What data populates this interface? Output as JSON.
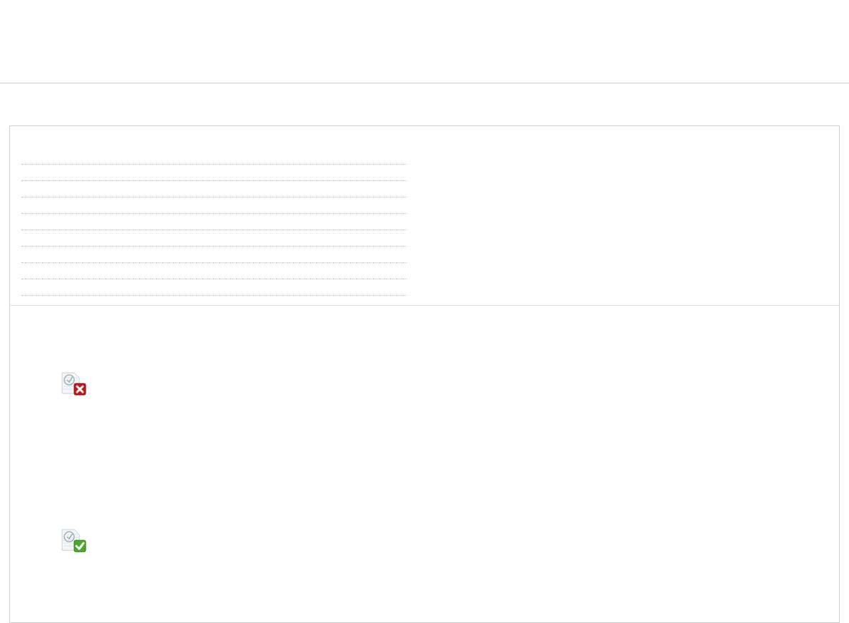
{
  "results": [
    {
      "kind": "failed"
    },
    {
      "kind": "passed"
    }
  ]
}
